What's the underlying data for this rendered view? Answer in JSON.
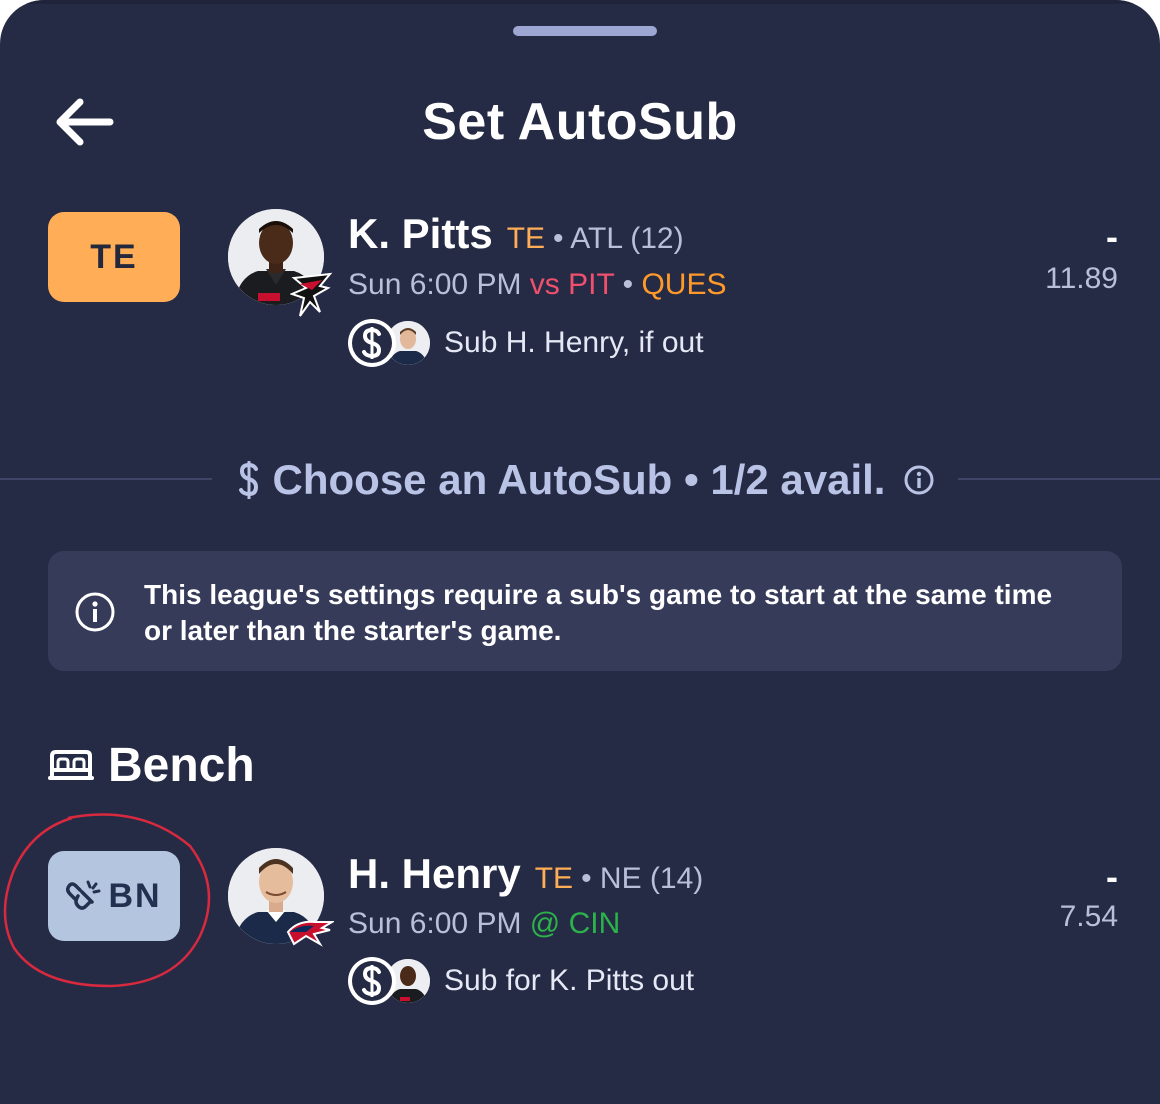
{
  "header": {
    "title": "Set AutoSub"
  },
  "starter": {
    "position_badge": "TE",
    "name": "K. Pitts",
    "position": "TE",
    "team": "• ATL (12)",
    "game_time": "Sun 6:00 PM",
    "opponent": "vs PIT",
    "separator": "•",
    "status": "QUES",
    "sub_text": "Sub H. Henry, if out",
    "proj_dash": "-",
    "proj_value": "11.89",
    "team_logo_text": "ATL"
  },
  "chooser": {
    "label": "Choose an AutoSub • 1/2 avail."
  },
  "notice": {
    "text": "This league's settings require a sub's game to start at the same time or later than the starter's game."
  },
  "bench": {
    "label": "Bench"
  },
  "bench_player": {
    "position_badge": "BN",
    "name": "H. Henry",
    "position": "TE",
    "team": "• NE (14)",
    "game_time": "Sun 6:00 PM",
    "opponent": "@ CIN",
    "sub_text": "Sub for K. Pitts out",
    "proj_dash": "-",
    "proj_value": "7.54"
  },
  "icons": {
    "back": "arrow-left-icon",
    "autosub": "autosub-s-icon",
    "info": "info-icon",
    "bench": "bed-icon",
    "link": "link-icon"
  },
  "colors": {
    "background": "#262b45",
    "te_badge": "#ffae57",
    "bn_badge": "#b4c6df",
    "opponent_away": "#f0506e",
    "opponent_home": "#2bb34a",
    "status_ques": "#ff9a2a",
    "highlight_ring": "#d8293f"
  }
}
